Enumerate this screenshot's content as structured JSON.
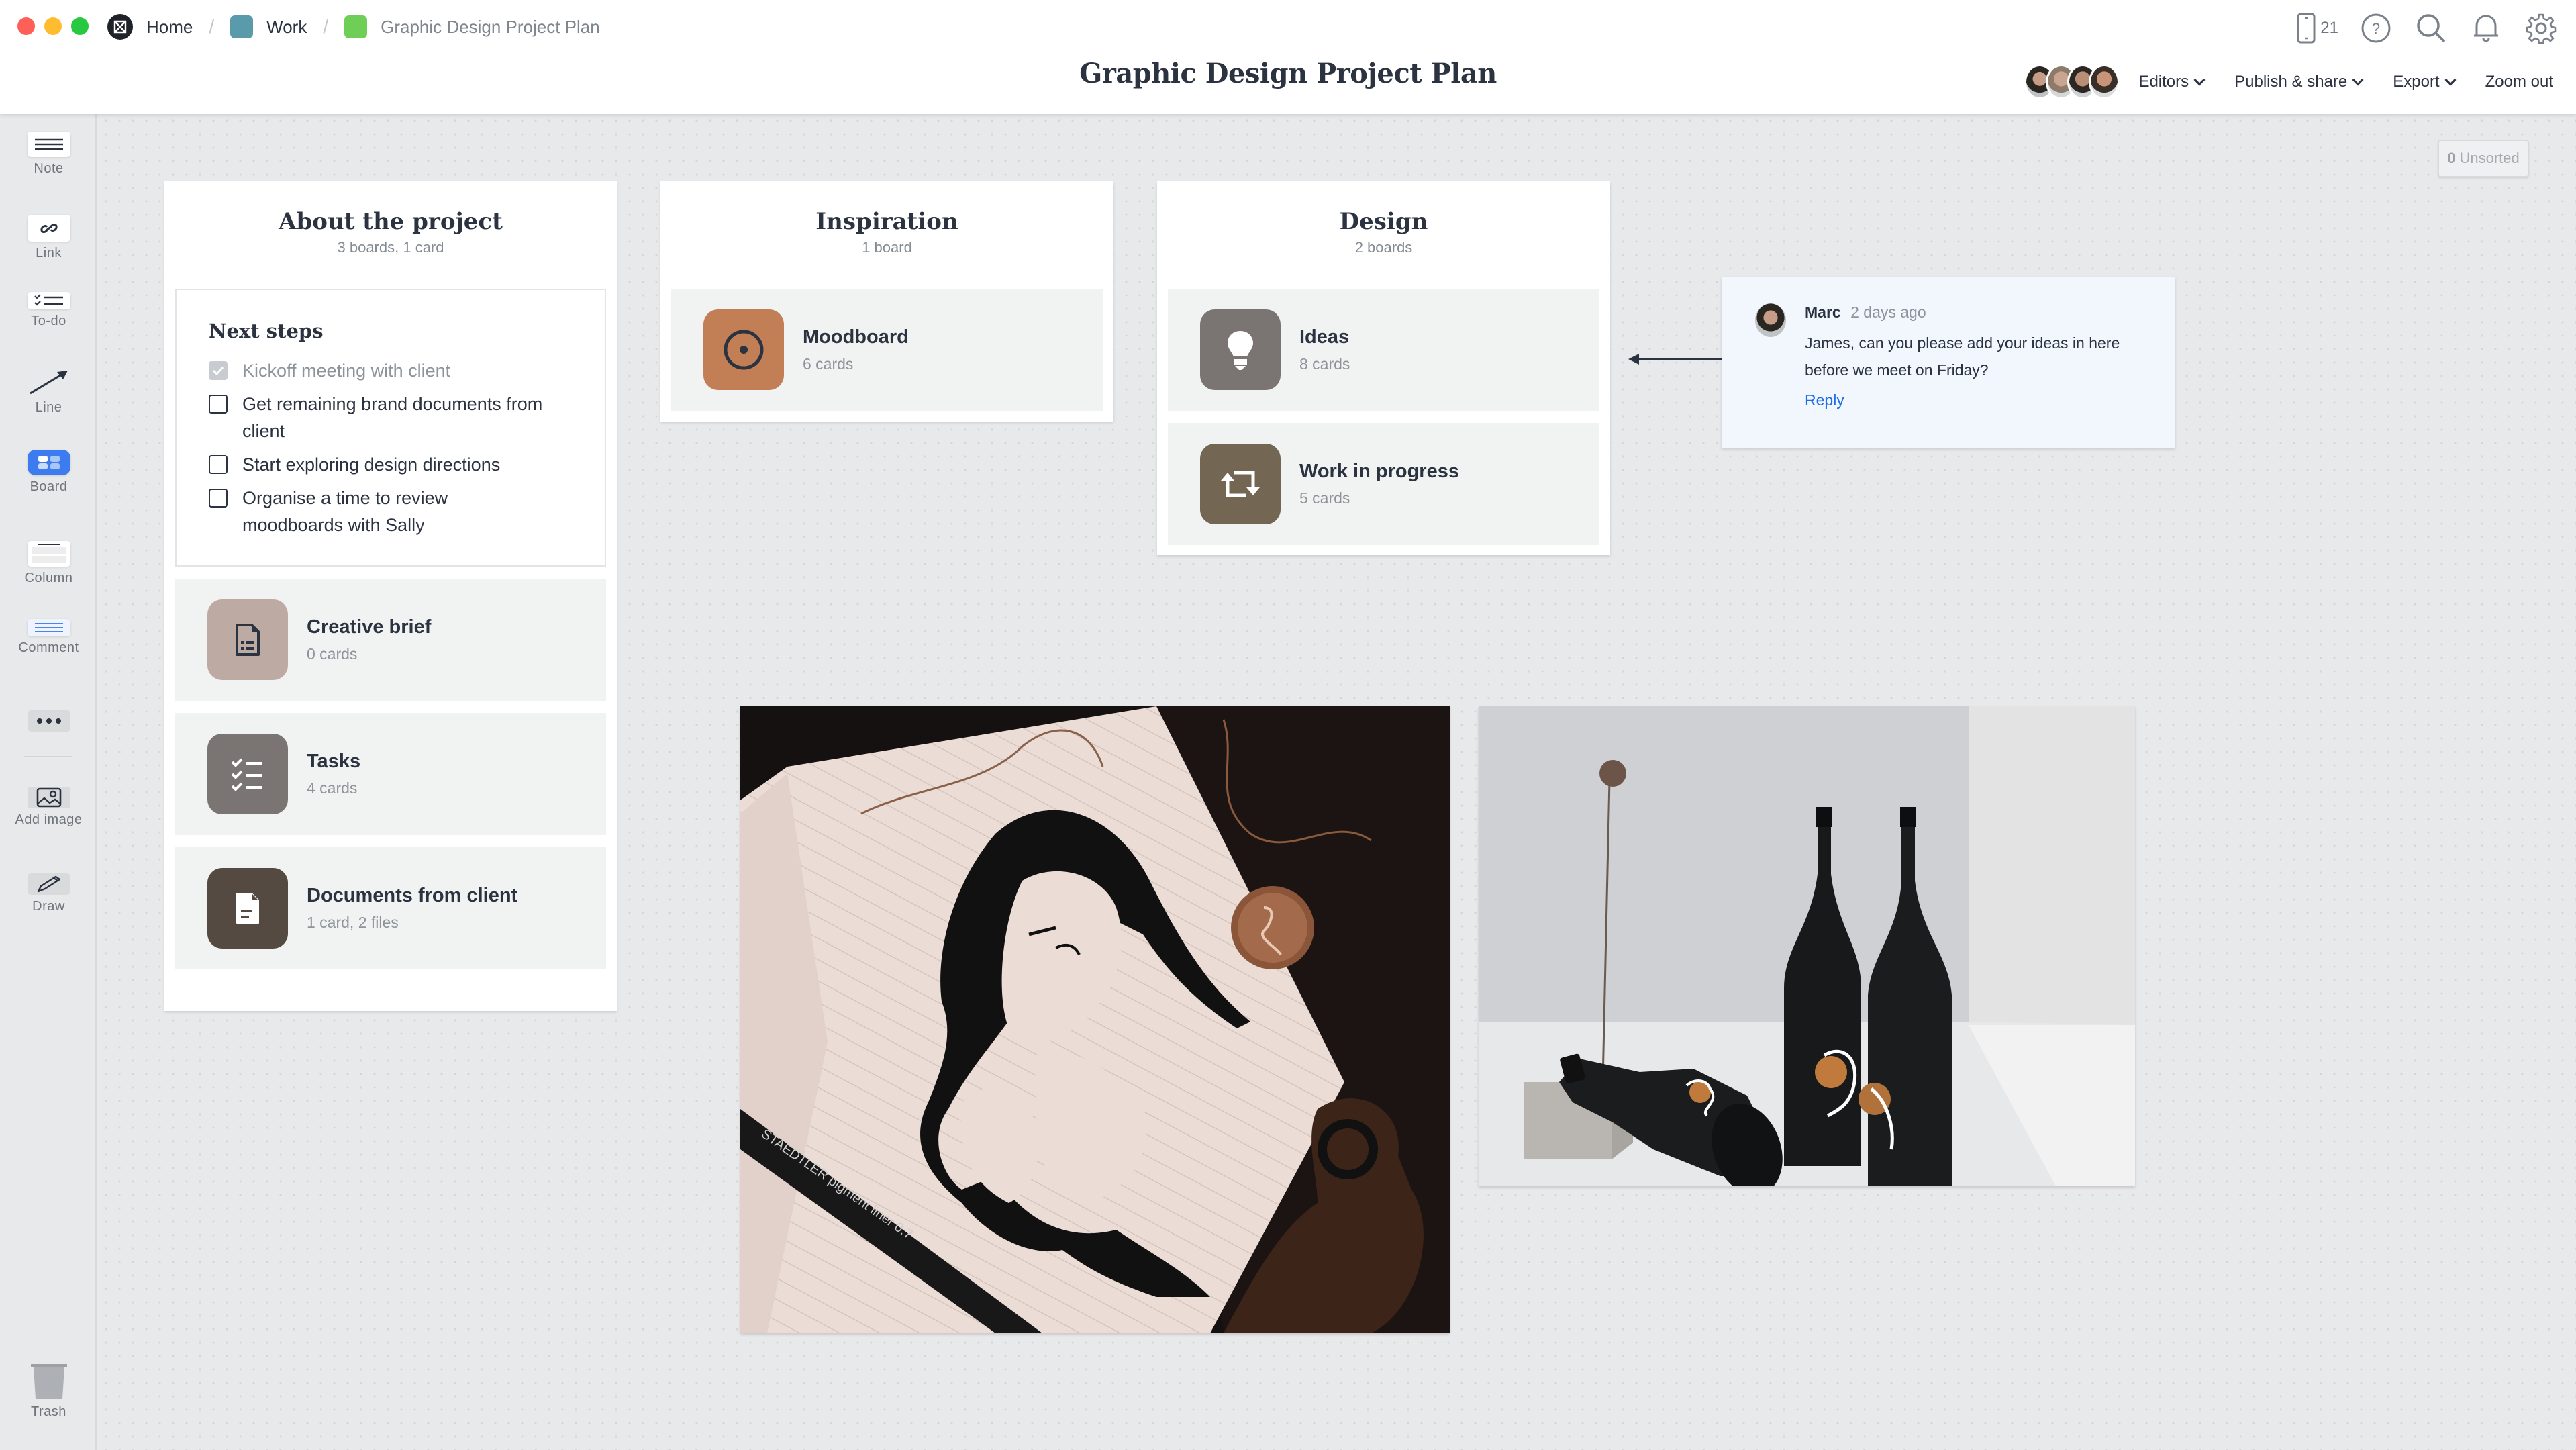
{
  "window": {
    "traffic_lights": [
      {
        "name": "close",
        "color": "#fe5f57"
      },
      {
        "name": "minimize",
        "color": "#febc2e"
      },
      {
        "name": "maximize",
        "color": "#28c840"
      }
    ]
  },
  "breadcrumb": [
    {
      "label": "Home",
      "icon": "milanote-logo-icon",
      "color": "#1f2329"
    },
    {
      "label": "Work",
      "icon": "board-square-icon",
      "color": "#5a9bab"
    },
    {
      "label": "Graphic Design Project Plan",
      "icon": "board-square-icon",
      "color": "#6fce55"
    }
  ],
  "header": {
    "title": "Graphic Design Project Plan",
    "device_count": "21",
    "icons": [
      "mobile-device-icon",
      "help-icon",
      "search-icon",
      "bell-icon",
      "gear-icon"
    ]
  },
  "toolbar": {
    "editors_label": "Editors",
    "publish_label": "Publish & share",
    "export_label": "Export",
    "zoom_label": "Zoom out",
    "avatar_count": 4
  },
  "sidebar": {
    "tools": [
      {
        "label": "Note",
        "icon": "note-icon"
      },
      {
        "label": "Link",
        "icon": "link-icon"
      },
      {
        "label": "To-do",
        "icon": "todo-icon"
      },
      {
        "label": "Line",
        "icon": "line-arrow-icon"
      },
      {
        "label": "Board",
        "icon": "board-icon"
      },
      {
        "label": "Column",
        "icon": "column-icon"
      },
      {
        "label": "Comment",
        "icon": "comment-icon"
      }
    ],
    "more_label": "more",
    "media_tools": [
      {
        "label": "Add image",
        "icon": "image-icon"
      },
      {
        "label": "Draw",
        "icon": "pencil-icon"
      }
    ],
    "trash_label": "Trash"
  },
  "unsorted": {
    "count": "0",
    "label": "Unsorted"
  },
  "columns": [
    {
      "title": "About the project",
      "subtitle": "3 boards, 1 card",
      "todo": {
        "title": "Next steps",
        "items": [
          {
            "text": "Kickoff meeting with client",
            "done": true
          },
          {
            "text": "Get remaining brand documents from client",
            "done": false
          },
          {
            "text": "Start exploring design directions",
            "done": false
          },
          {
            "text": "Organise a time to review moodboards with Sally",
            "done": false
          }
        ]
      },
      "boards": [
        {
          "name": "Creative brief",
          "count": "0 cards",
          "icon": "document-list-icon",
          "color": "#bcaaa3"
        },
        {
          "name": "Tasks",
          "count": "4 cards",
          "icon": "checklist-icon",
          "color": "#7a7573"
        },
        {
          "name": "Documents from client",
          "count": "1 card, 2 files",
          "icon": "document-icon",
          "color": "#544a41"
        }
      ]
    },
    {
      "title": "Inspiration",
      "subtitle": "1 board",
      "boards": [
        {
          "name": "Moodboard",
          "count": "6 cards",
          "icon": "target-circle-icon",
          "color": "#c27e54"
        }
      ]
    },
    {
      "title": "Design",
      "subtitle": "2 boards",
      "boards": [
        {
          "name": "Ideas",
          "count": "8 cards",
          "icon": "lightbulb-icon",
          "color": "#7a7573"
        },
        {
          "name": "Work in progress",
          "count": "5 cards",
          "icon": "repeat-arrows-icon",
          "color": "#736753"
        }
      ]
    }
  ],
  "comment": {
    "author": "Marc",
    "time": "2 days ago",
    "body": "James, can you please add your ideas in here before we meet on Friday?",
    "reply_label": "Reply"
  },
  "images": [
    {
      "description": "Ink line drawing of overlapping female faces in a lined notebook with a Staedtler pigment liner pen and jewellery"
    },
    {
      "description": "Three dark wine bottles with abstract orange-and-white labels beside a dried flower on a white surface"
    }
  ],
  "colors": {
    "accent_blue": "#3d7cf0",
    "link_blue": "#1f6ee8",
    "text_dark": "#2b3240",
    "text_muted": "#8d939a",
    "canvas_bg": "#e8e9eb"
  }
}
